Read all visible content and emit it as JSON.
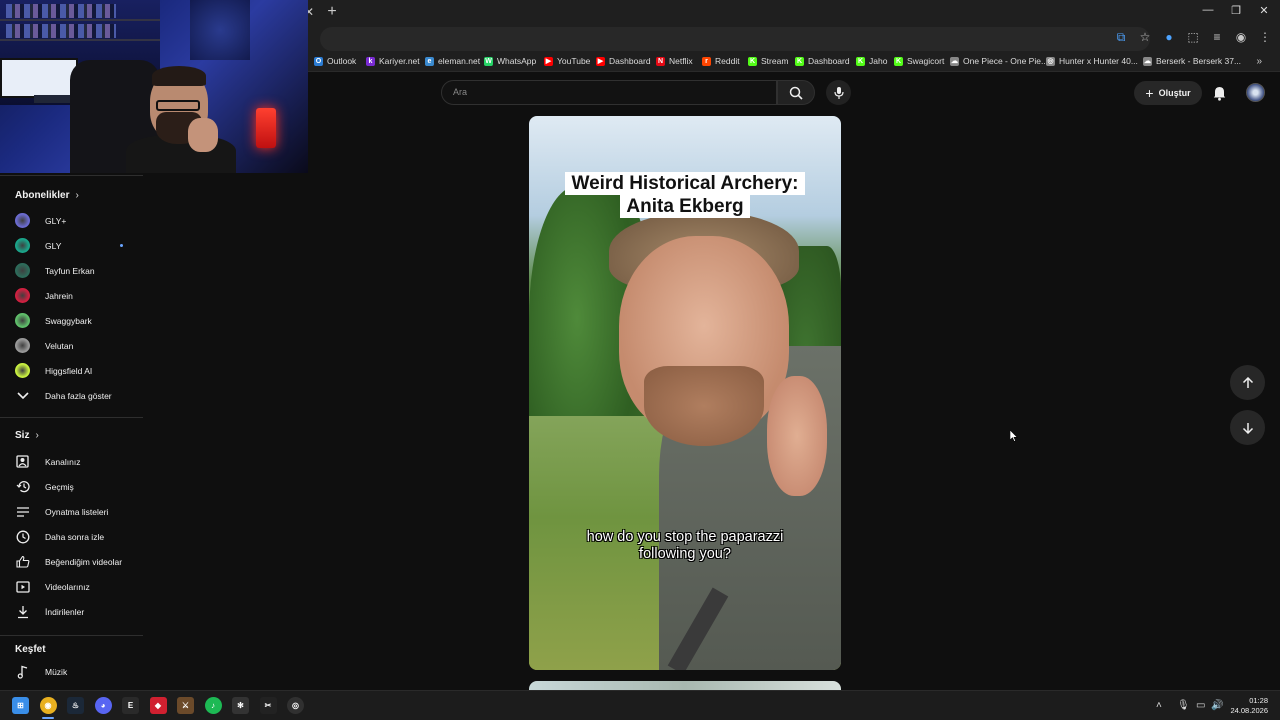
{
  "browser": {
    "window_controls": {
      "minimize": "—",
      "restore": "❐",
      "close": "✕"
    },
    "tab_close": "✕",
    "new_tab": "+",
    "bookmarks": [
      {
        "label": "Outlook",
        "color": "#2b7cd3",
        "glyph": "O"
      },
      {
        "label": "Kariyer.net",
        "color": "#7a2bd3",
        "glyph": "k"
      },
      {
        "label": "eleman.net",
        "color": "#3a8ad0",
        "glyph": "e"
      },
      {
        "label": "WhatsApp",
        "color": "#25d366",
        "glyph": "W"
      },
      {
        "label": "YouTube",
        "color": "#ff0000",
        "glyph": "▶"
      },
      {
        "label": "Dashboard",
        "color": "#ff0000",
        "glyph": "▶"
      },
      {
        "label": "Netflix",
        "color": "#e50914",
        "glyph": "N"
      },
      {
        "label": "Reddit",
        "color": "#ff4500",
        "glyph": "r"
      },
      {
        "label": "Stream",
        "color": "#53fc18",
        "glyph": "K"
      },
      {
        "label": "Dashboard",
        "color": "#53fc18",
        "glyph": "K"
      },
      {
        "label": "Jaho",
        "color": "#53fc18",
        "glyph": "K"
      },
      {
        "label": "Swagicort",
        "color": "#53fc18",
        "glyph": "K"
      },
      {
        "label": "One Piece - One Pie...",
        "color": "#888888",
        "glyph": "☁"
      },
      {
        "label": "Hunter x Hunter 40...",
        "color": "#888888",
        "glyph": "◎"
      },
      {
        "label": "Berserk - Berserk 37...",
        "color": "#888888",
        "glyph": "☁"
      }
    ],
    "bookmarks_more": "»"
  },
  "youtube": {
    "search_placeholder": "Ara",
    "create_label": "Oluştur",
    "sidebar": {
      "subscriptions_title": "Abonelikler",
      "subscriptions": [
        {
          "label": "GLY+",
          "color": "#6b6bd0"
        },
        {
          "label": "GLY",
          "color": "#1aa58a",
          "new": true
        },
        {
          "label": "Tayfun Erkan",
          "color": "#2d6b5a"
        },
        {
          "label": "Jahrein",
          "color": "#d02040"
        },
        {
          "label": "Swaggybark",
          "color": "#5fbf6a"
        },
        {
          "label": "Velutan",
          "color": "#999999"
        },
        {
          "label": "Higgsfield AI",
          "color": "#c8f040"
        }
      ],
      "show_more": "Daha fazla göster",
      "you_title": "Siz",
      "you_items": [
        {
          "label": "Kanalınız",
          "icon": "channel-icon"
        },
        {
          "label": "Geçmiş",
          "icon": "history-icon"
        },
        {
          "label": "Oynatma listeleri",
          "icon": "playlists-icon"
        },
        {
          "label": "Daha sonra izle",
          "icon": "watch-later-icon"
        },
        {
          "label": "Beğendiğim videolar",
          "icon": "liked-icon"
        },
        {
          "label": "Videolarınız",
          "icon": "your-videos-icon"
        },
        {
          "label": "İndirilenler",
          "icon": "downloads-icon"
        }
      ],
      "explore_title": "Keşfet",
      "explore_items": [
        {
          "label": "Müzik",
          "icon": "music-icon"
        }
      ]
    },
    "short": {
      "title_line1": "Weird Historical Archery:",
      "title_line2": "Anita Ekberg",
      "caption_line1": "how do you stop the paparazzi",
      "caption_line2": "following you?"
    }
  },
  "taskbar": {
    "time": "01:28",
    "date": "24.08.2026",
    "apps": [
      "start-icon",
      "chrome-icon",
      "steam-icon",
      "discord-icon",
      "epic-icon",
      "app-red-icon",
      "app-game-icon",
      "spotify-icon",
      "steelseries-icon",
      "capcut-icon",
      "obs-icon"
    ]
  }
}
